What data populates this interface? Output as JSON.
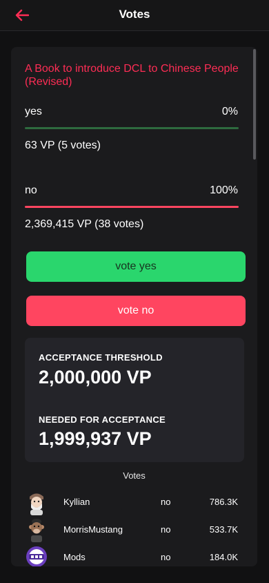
{
  "header": {
    "title": "Votes",
    "back_icon": "arrow-left-icon",
    "accent_color": "#ff2d55"
  },
  "proposal": {
    "title": "A Book to introduce DCL to Chinese People (Revised)",
    "options": [
      {
        "label": "yes",
        "percent": "0%",
        "vp": "63 VP (5 votes)",
        "bar_color": "#2e6b3f"
      },
      {
        "label": "no",
        "percent": "100%",
        "vp": "2,369,415 VP (38 votes)",
        "bar_color": "#ff4560"
      }
    ]
  },
  "actions": {
    "vote_yes": "vote yes",
    "vote_no": "vote no"
  },
  "stats": {
    "threshold_label": "ACCEPTANCE THRESHOLD",
    "threshold_value": "2,000,000 VP",
    "needed_label": "NEEDED FOR ACCEPTANCE",
    "needed_value": "1,999,937 VP"
  },
  "voters": {
    "heading": "Votes",
    "rows": [
      {
        "name": "Kyllian",
        "choice": "no",
        "vp": "786.3K"
      },
      {
        "name": "MorrisMustang",
        "choice": "no",
        "vp": "533.7K"
      },
      {
        "name": "Mods",
        "choice": "no",
        "vp": "184.0K"
      }
    ]
  }
}
